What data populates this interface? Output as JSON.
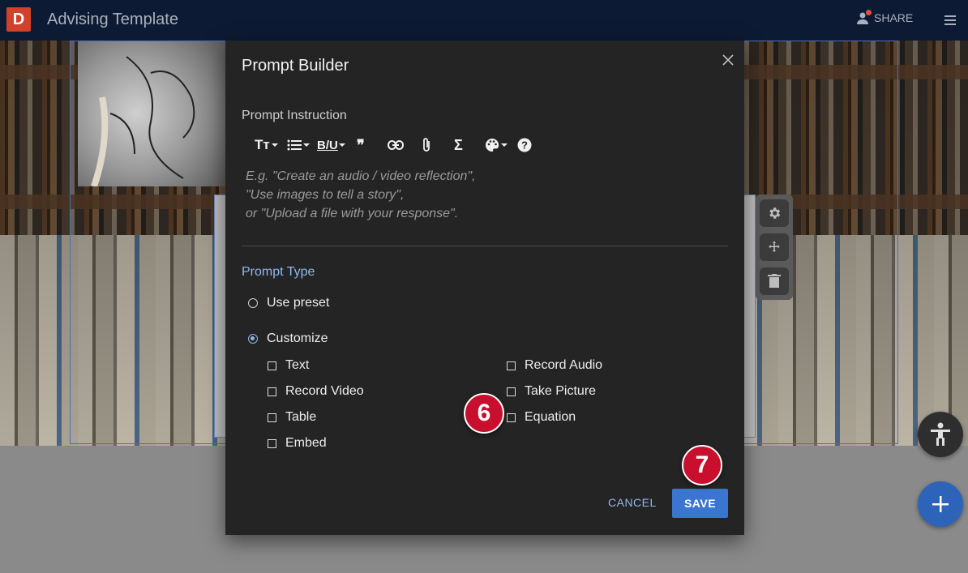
{
  "app": {
    "logo_letter": "D",
    "title": "Advising Template",
    "share_label": "SHARE"
  },
  "dialog": {
    "title": "Prompt Builder",
    "instruction_label": "Prompt Instruction",
    "placeholder_lines": [
      "E.g. \"Create an audio / video reflection\",",
      "\"Use images to tell a story\",",
      "or \"Upload a file with your response\"."
    ],
    "prompt_type_label": "Prompt Type",
    "options": {
      "preset": "Use preset",
      "customize": "Customize",
      "selected": "customize"
    },
    "types_left": [
      "Text",
      "Record Video",
      "Table",
      "Embed"
    ],
    "types_right": [
      "Record Audio",
      "Take Picture",
      "Equation"
    ],
    "cancel_label": "CANCEL",
    "save_label": "SAVE"
  },
  "toolbar": {
    "text_style_icon": "Tт",
    "bold_underline_icon": "B/U",
    "quote_icon": "❞",
    "sigma_icon": "Σ"
  },
  "callouts": {
    "step6": "6",
    "step7": "7"
  },
  "colors": {
    "accent": "#3a76d0",
    "link": "#8fb8ee",
    "callout": "#c8102e",
    "topbar": "#0d1a33",
    "logo": "#d2422b"
  }
}
